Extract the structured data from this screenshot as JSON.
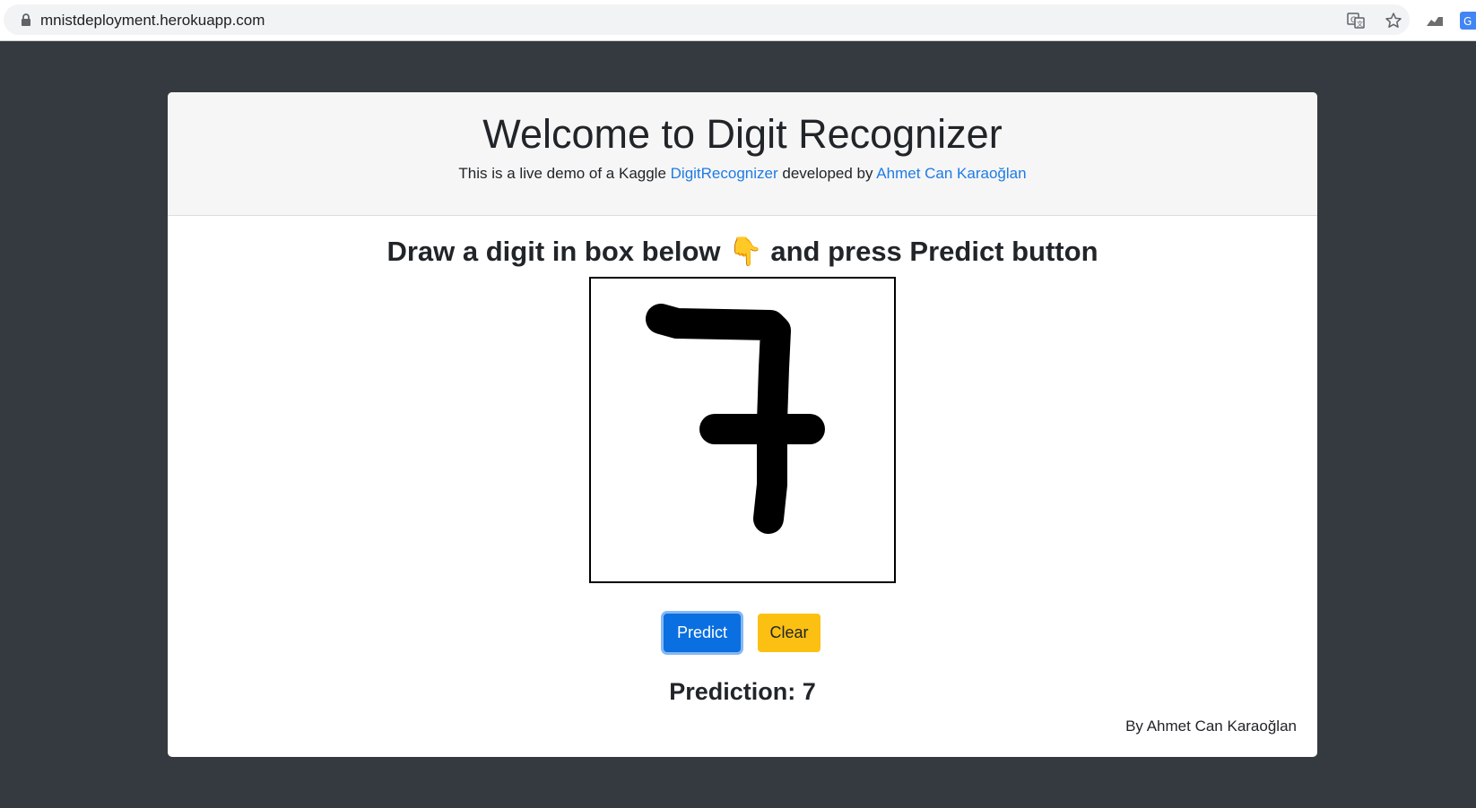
{
  "browser": {
    "url": "mnistdeployment.herokuapp.com",
    "icons": [
      "lock-icon",
      "translate-icon",
      "star-icon",
      "extension-icon",
      "google-extension-icon"
    ]
  },
  "header": {
    "title": "Welcome to Digit Recognizer",
    "subtitle_prefix": "This is a live demo of a Kaggle ",
    "subtitle_link1": "DigitRecognizer",
    "subtitle_middle": " developed by ",
    "subtitle_link2": "Ahmet Can Karaoğlan"
  },
  "main": {
    "instruction_before": "Draw a digit in box below ",
    "instruction_emoji": "👇",
    "instruction_after": " and press Predict button",
    "canvas": {
      "drawn_digit": "7",
      "stroke_color": "#000000",
      "background": "#ffffff"
    },
    "predict_button": "Predict",
    "clear_button": "Clear",
    "prediction_label": "Prediction:",
    "prediction_value": "7"
  },
  "footer": {
    "credit": "By Ahmet Can Karaoğlan"
  },
  "colors": {
    "page_background": "#343a40",
    "link": "#1e7be6",
    "primary": "#0a6fe0",
    "warning": "#fbc011"
  }
}
